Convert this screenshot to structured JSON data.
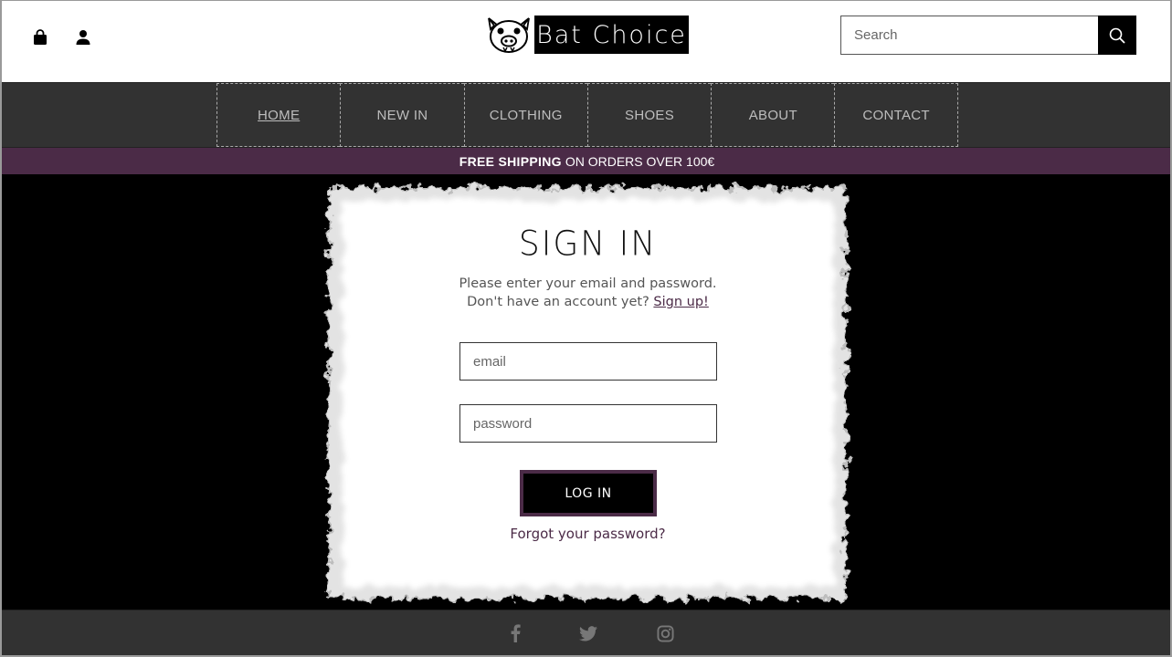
{
  "header": {
    "brand": "Bat Choice",
    "search": {
      "placeholder": "Search",
      "value": ""
    },
    "icons": [
      "shopping-bag-icon",
      "user-icon",
      "search-icon"
    ]
  },
  "nav": {
    "items": [
      {
        "label": "HOME",
        "active": true
      },
      {
        "label": "NEW IN",
        "active": false
      },
      {
        "label": "CLOTHING",
        "active": false
      },
      {
        "label": "SHOES",
        "active": false
      },
      {
        "label": "ABOUT",
        "active": false
      },
      {
        "label": "CONTACT",
        "active": false
      }
    ]
  },
  "banner": {
    "bold": "FREE SHIPPING",
    "rest": "ON ORDERS OVER 100€"
  },
  "signin": {
    "title": "SIGN IN",
    "line1": "Please enter your email and password.",
    "line2": "Don't have an account yet?",
    "signup_link": "Sign up!",
    "email_placeholder": "email",
    "password_placeholder": "password",
    "login_label": "LOG IN",
    "forgot_label": "Forgot your password?"
  },
  "footer": {
    "icons": [
      "facebook-icon",
      "twitter-icon",
      "instagram-icon"
    ]
  },
  "colors": {
    "accent": "#4b2b47",
    "nav_bg": "#323232",
    "main_bg": "#000000"
  }
}
